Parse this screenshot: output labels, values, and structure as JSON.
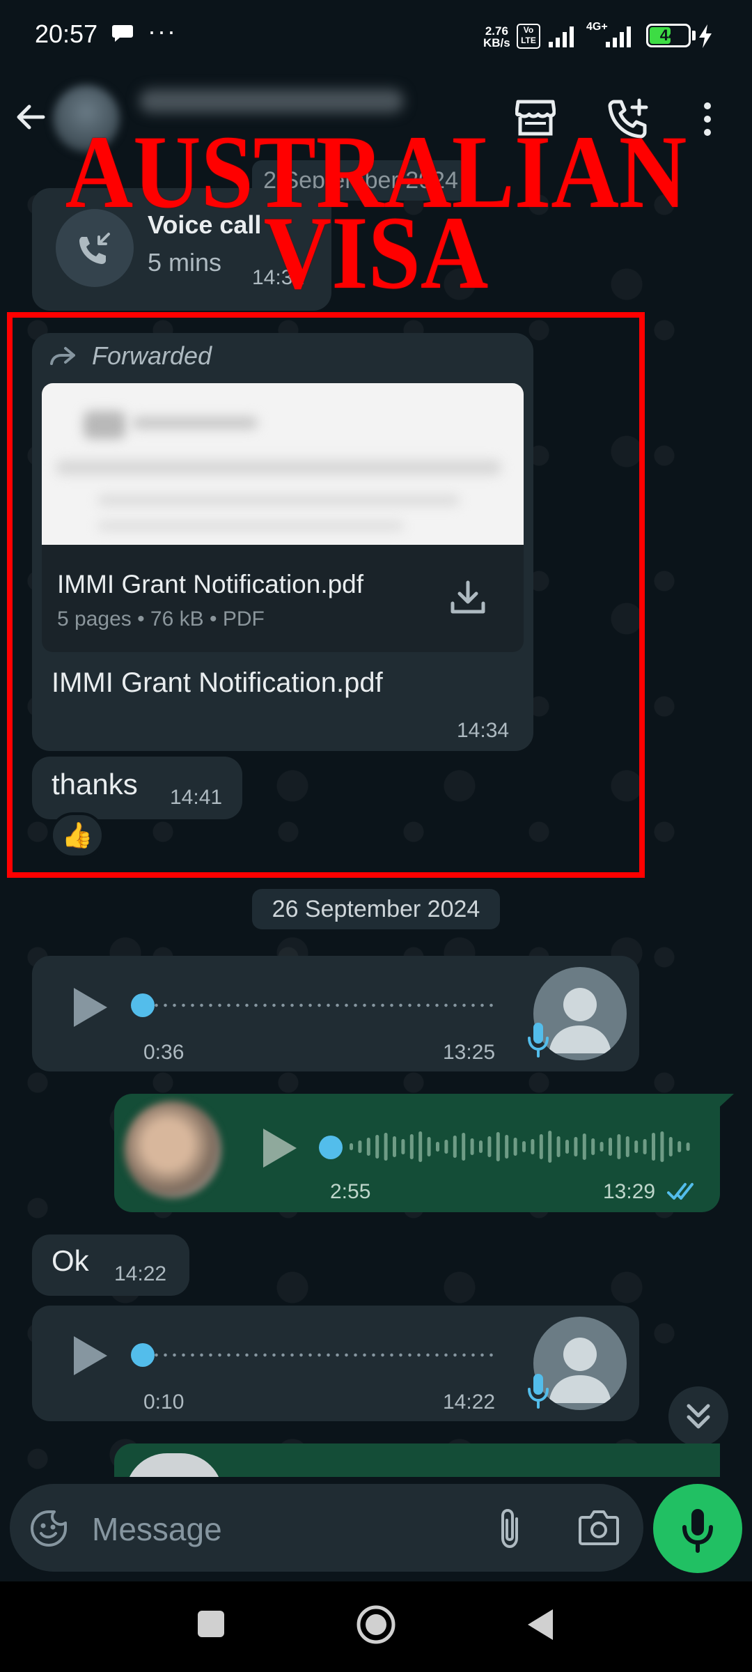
{
  "status_bar": {
    "time": "20:57",
    "more": "···",
    "speed": "2.76\nKB/s",
    "volte": "Vo\nLTE",
    "network": "4G+",
    "battery": "44"
  },
  "overlay": {
    "line1": "AUSTRALIAN",
    "line2": "VISA"
  },
  "messages": {
    "date_chip_1": "2 September 2024",
    "voice_call": {
      "title": "Voice call",
      "duration": "5 mins",
      "time": "14:31"
    },
    "document": {
      "forwarded_label": "Forwarded",
      "filename": "IMMI Grant Notification.pdf",
      "details": "5 pages • 76 kB • PDF",
      "caption": "IMMI Grant Notification.pdf",
      "time": "14:34"
    },
    "thanks": {
      "text": "thanks",
      "time": "14:41",
      "reaction": "👍"
    },
    "date_chip_2": "26 September 2024",
    "voice_note_1": {
      "duration": "0:36",
      "time": "13:25"
    },
    "voice_note_2": {
      "duration": "2:55",
      "time": "13:29"
    },
    "ok": {
      "text": "Ok",
      "time": "14:22"
    },
    "voice_note_3": {
      "duration": "0:10",
      "time": "14:22"
    }
  },
  "composer": {
    "placeholder": "Message"
  },
  "colors": {
    "background": "#0b141a",
    "incoming_bubble": "#202c33",
    "outgoing_bubble": "#144d37",
    "accent_green": "#21c063",
    "voice_dot": "#53bdeb",
    "overlay_red": "#ff0000"
  },
  "icons": [
    "back-arrow-icon",
    "shop-icon",
    "call-add-icon",
    "menu-icon",
    "missed-call-icon",
    "forward-icon",
    "download-icon",
    "play-icon",
    "mic-icon",
    "double-tick-icon",
    "chevron-double-down-icon",
    "emoji-icon",
    "attach-icon",
    "camera-icon",
    "nav-square-icon",
    "nav-home-icon",
    "nav-back-icon"
  ]
}
